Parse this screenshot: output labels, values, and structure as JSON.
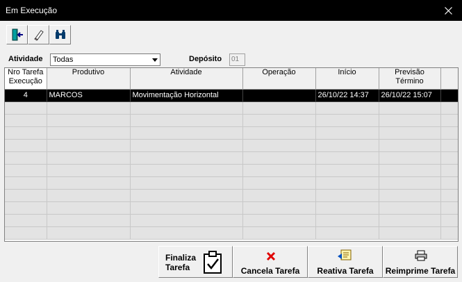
{
  "window": {
    "title": "Em Execução"
  },
  "toolbar": {
    "icons": [
      "exit-door-icon",
      "eraser-icon",
      "binoculars-icon"
    ]
  },
  "filters": {
    "atividade_label": "Atividade",
    "atividade_value": "Todas",
    "deposito_label": "Depósito",
    "deposito_value": "01"
  },
  "table": {
    "headers": [
      "Nro Tarefa\nExecução",
      "Produtivo",
      "Atividade",
      "Operação",
      "Início",
      "Previsão\nTérmino"
    ],
    "rows": [
      [
        "4",
        "MARCOS",
        "Movimentação Horizontal",
        "",
        "26/10/22  14:37",
        "26/10/22  15:07"
      ]
    ],
    "empty_rows": 11,
    "selected_row": 0
  },
  "buttons": {
    "finaliza": "Finaliza\nTarefa",
    "cancela": "Cancela Tarefa",
    "reativa": "Reativa Tarefa",
    "reimprime": "Reimprime Tarefa"
  },
  "colors": {
    "titlebar": "#000000",
    "selected_row": "#000000",
    "cancel_icon": "#e00000"
  }
}
